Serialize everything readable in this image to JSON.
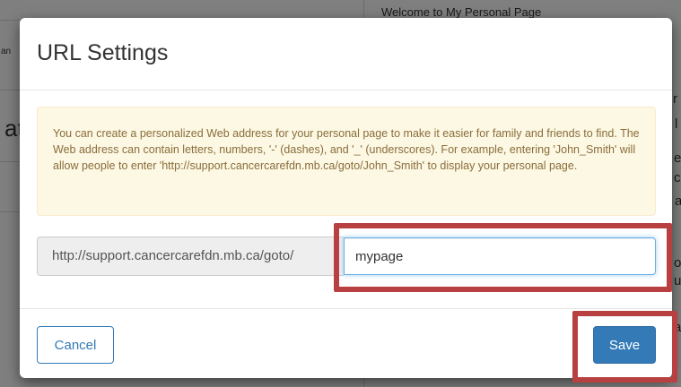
{
  "background": {
    "welcome_text": "Welcome to My Personal Page",
    "fragments": [
      "an",
      "at",
      "r",
      "l",
      "e",
      "c",
      "a",
      "o",
      "u",
      "a"
    ]
  },
  "modal": {
    "title": "URL Settings",
    "info_text": "You can create a personalized Web address for your personal page to make it easier for family and friends to find. The Web address can contain letters, numbers, '-' (dashes), and '_' (underscores). For example, entering 'John_Smith' will allow people to enter 'http://support.cancercarefdn.mb.ca/goto/John_Smith' to display your personal page.",
    "url_prefix": "http://support.cancercarefdn.mb.ca/goto/",
    "url_value": "mypage",
    "cancel_label": "Cancel",
    "save_label": "Save"
  },
  "colors": {
    "primary": "#337ab7",
    "alert_bg": "#fcf8e3",
    "alert_text": "#8a6d3b",
    "highlight": "#b84040"
  }
}
